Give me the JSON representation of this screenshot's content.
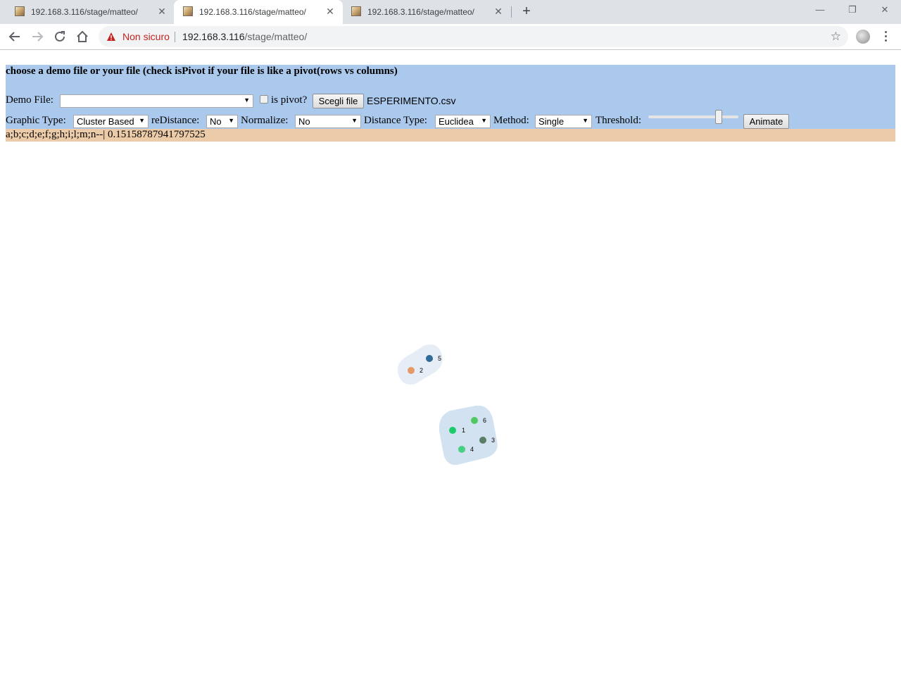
{
  "browser": {
    "tabs": [
      {
        "title": "192.168.3.116/stage/matteo/",
        "active": false
      },
      {
        "title": "192.168.3.116/stage/matteo/",
        "active": true
      },
      {
        "title": "192.168.3.116/stage/matteo/",
        "active": false
      }
    ],
    "security_label": "Non sicuro",
    "url_host": "192.168.3.116",
    "url_path": "/stage/matteo/"
  },
  "page": {
    "heading": "choose a demo file or your file (check isPivot if your file is like a pivot(rows vs columns)",
    "demo_file_label": "Demo File:",
    "demo_file_value": "",
    "is_pivot_label": "is pivot?",
    "is_pivot_checked": false,
    "choose_file_button": "Scegli file",
    "chosen_file": "ESPERIMENTO.csv",
    "graphic_type_label": "Graphic Type:",
    "graphic_type_value": "Cluster Based",
    "redistance_label": "reDistance:",
    "redistance_value": "No",
    "normalize_label": "Normalize:",
    "normalize_value": "No",
    "distance_type_label": "Distance Type:",
    "distance_type_value": "Euclidea",
    "method_label": "Method:",
    "method_value": "Single",
    "threshold_label": "Threshold:",
    "threshold_level": 0.78,
    "animate_button": "Animate",
    "result_text": "a;b;c;d;e;f;g;h;i;l;m;n--| 0.15158787941797525"
  },
  "clusters": [
    {
      "fill": "#e6edf6",
      "nodes": [
        {
          "label": "5",
          "color": "#2e6b96"
        },
        {
          "label": "2",
          "color": "#e59a66"
        }
      ]
    },
    {
      "fill": "#d2e2f0",
      "nodes": [
        {
          "label": "6",
          "color": "#4fc862"
        },
        {
          "label": "1",
          "color": "#1bcb6a"
        },
        {
          "label": "3",
          "color": "#5a7d68"
        },
        {
          "label": "4",
          "color": "#48cf84"
        }
      ]
    }
  ]
}
